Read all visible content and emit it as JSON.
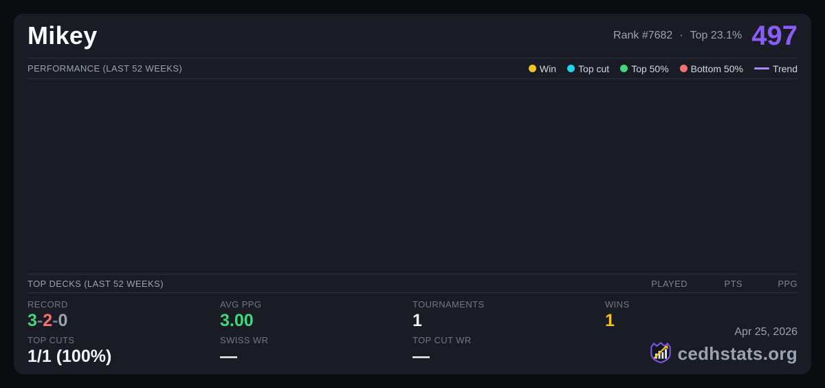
{
  "header": {
    "player_name": "Mikey",
    "rank_text": "Rank #7682",
    "separator": "·",
    "top_percent_text": "Top 23.1%",
    "points": "497"
  },
  "performance": {
    "title": "PERFORMANCE (LAST 52 WEEKS)",
    "legend": {
      "items": [
        {
          "label": "Win",
          "icon": "win-dot",
          "color": "#f0c41f"
        },
        {
          "label": "Top cut",
          "icon": "top-cut-dot",
          "color": "#22d3ee"
        },
        {
          "label": "Top 50%",
          "icon": "top-50-dot",
          "color": "#41d87d"
        },
        {
          "label": "Bottom 50%",
          "icon": "bottom-50-dot",
          "color": "#f87171"
        }
      ],
      "trend": {
        "label": "Trend",
        "icon": "trend-line",
        "color": "#a78bfa"
      }
    },
    "chart_points": []
  },
  "top_decks": {
    "title": "TOP DECKS (LAST 52 WEEKS)",
    "columns": [
      "PLAYED",
      "PTS",
      "PPG"
    ],
    "rows": []
  },
  "stats": {
    "record": {
      "label": "RECORD",
      "wins": "3",
      "sep1": "-",
      "losses": "2",
      "sep2": "-",
      "draws": "0"
    },
    "avg_ppg": {
      "label": "AVG PPG",
      "value": "3.00"
    },
    "tournaments": {
      "label": "TOURNAMENTS",
      "value": "1"
    },
    "wins": {
      "label": "WINS",
      "value": "1"
    },
    "top_cuts": {
      "label": "TOP CUTS",
      "value": "1/1 (100%)"
    },
    "swiss_wr": {
      "label": "SWISS WR",
      "value": "—"
    },
    "top_cut_wr": {
      "label": "TOP CUT WR",
      "value": "—"
    }
  },
  "footer": {
    "date": "Apr 25, 2026",
    "brand": "cedhstats.org",
    "logo": "shield-bar-chart-arrow-logo"
  },
  "colors": {
    "page_background": "#0b0c10",
    "card_background": "#1a1c25",
    "divider": "#2e3342",
    "accent_purple": "#8b5cf6",
    "trend_purple": "#a78bfa",
    "win_gold": "#f0c41f",
    "green": "#41d87d",
    "red": "#f87171",
    "cyan": "#22d3ee",
    "text_primary": "#f3f4f6",
    "text_muted": "#9aa3b2",
    "text_faint": "#707786"
  }
}
